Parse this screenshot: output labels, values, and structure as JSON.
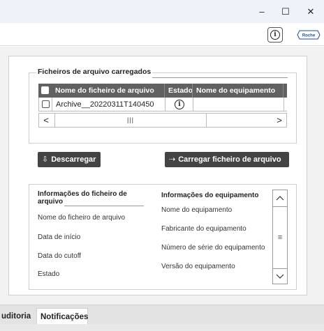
{
  "window": {
    "minimize": "–",
    "maximize": "☐",
    "close": "✕"
  },
  "topbar": {
    "info_icon": "info-icon",
    "logo_text": "Roche"
  },
  "uploaded_files": {
    "title": "Ficheiros de arquivo carregados",
    "columns": [
      "Nome do ficheiro de arquivo",
      "Estado",
      "Nome do equipamento"
    ],
    "rows": [
      {
        "file_name": "Archive__20220311T140450",
        "status_icon": "info-icon",
        "equipment_name": ""
      }
    ],
    "scroll_left": "<",
    "scroll_thumb": "|||",
    "scroll_right": ">"
  },
  "actions": {
    "download_label": "Descarregar",
    "download_icon": "⇩",
    "upload_label": "Carregar ficheiro de arquivo",
    "upload_icon": "⇢"
  },
  "file_info": {
    "title": "Informações do ficheiro de arquivo",
    "labels": [
      "Nome do ficheiro de arquivo",
      "Data de início",
      "Data do cutoff",
      "Estado"
    ]
  },
  "equipment_info": {
    "title": "Informações do equipamento",
    "labels": [
      "Nome do equipamento",
      "Fabricante do equipamento",
      "Número de série do equipamento",
      "Versão do equipamento"
    ]
  },
  "vscroll": {
    "up": "^",
    "thumb": "≡",
    "down": "v"
  },
  "tabs": [
    {
      "label": "uditoria",
      "active": false
    },
    {
      "label": "Notificações",
      "active": true
    }
  ],
  "status": {
    "text": ""
  }
}
